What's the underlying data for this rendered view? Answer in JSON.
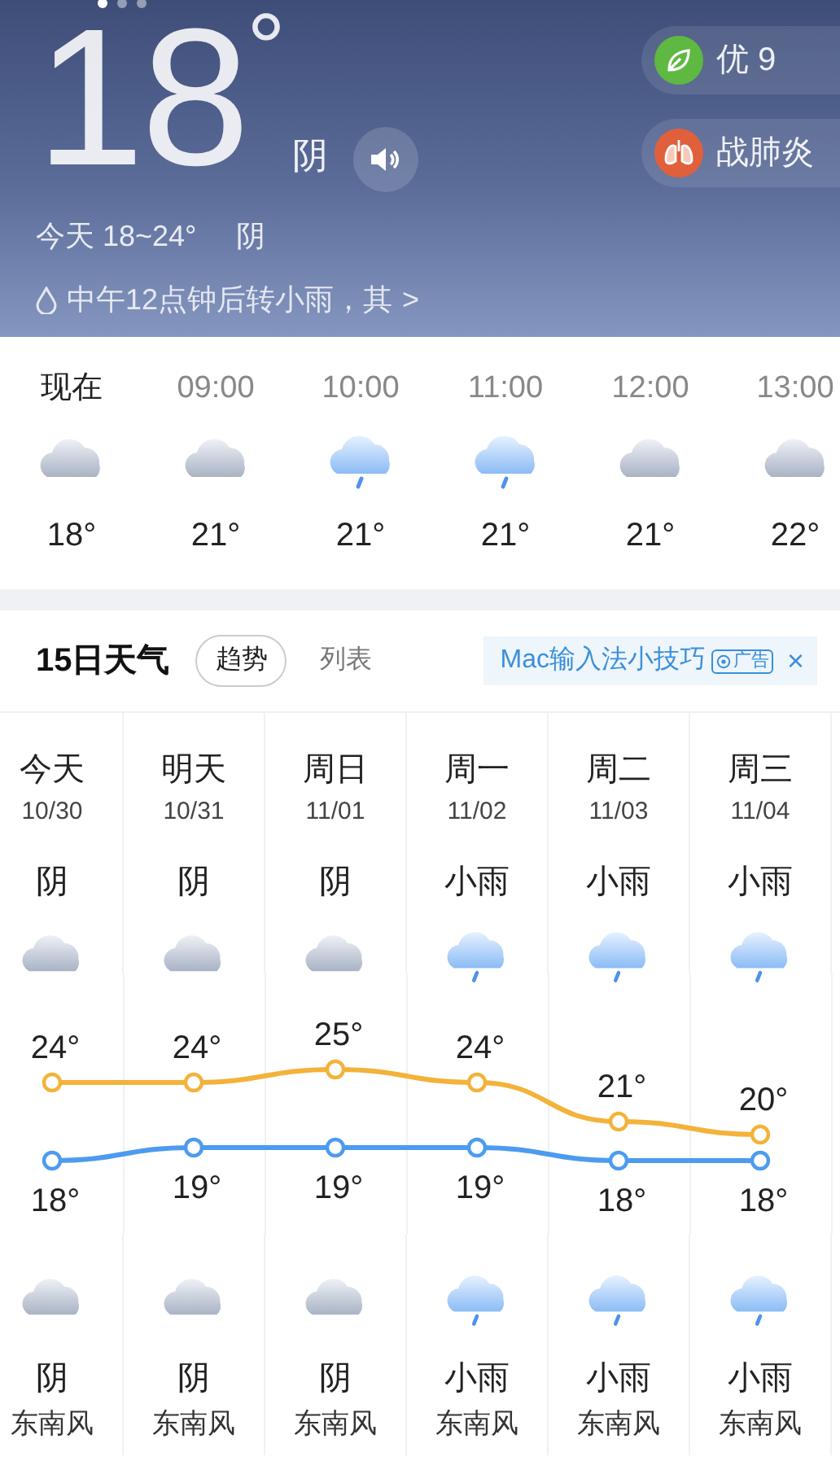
{
  "header": {
    "pager": [
      {
        "selected": true
      },
      {
        "selected": false
      },
      {
        "selected": false
      }
    ],
    "temperature": "18",
    "unit": "°",
    "condition": "阴",
    "badges": [
      {
        "kind": "air",
        "label": "优 9"
      },
      {
        "kind": "health",
        "label": "战肺炎"
      }
    ],
    "today_range": "今天 18~24°",
    "today_condition": "阴",
    "alert": {
      "text": "中午12点钟后转小雨，其",
      "chevron": ">"
    }
  },
  "hourly": [
    {
      "time": "现在",
      "kind": "now",
      "icon": {
        "kind": "cloudy"
      },
      "temp": "18°"
    },
    {
      "time": "09:00",
      "kind": "hour",
      "icon": {
        "kind": "cloudy"
      },
      "temp": "21°"
    },
    {
      "time": "10:00",
      "kind": "hour",
      "icon": {
        "kind": "rain"
      },
      "temp": "21°"
    },
    {
      "time": "11:00",
      "kind": "hour",
      "icon": {
        "kind": "rain"
      },
      "temp": "21°"
    },
    {
      "time": "12:00",
      "kind": "hour",
      "icon": {
        "kind": "cloudy"
      },
      "temp": "21°"
    },
    {
      "time": "13:00",
      "kind": "hour",
      "icon": {
        "kind": "cloudy"
      },
      "temp": "22°"
    }
  ],
  "forecast": {
    "title": "15日天气",
    "tabs": [
      {
        "label": "趋势",
        "selected": true
      },
      {
        "label": "列表",
        "selected": false
      }
    ],
    "ad": {
      "text": "Mac输入法小技巧",
      "tag": "广告",
      "close": "×"
    },
    "days": [
      {
        "name": "今天",
        "date": "10/30",
        "day_condition": "阴",
        "day_icon": {
          "kind": "cloudy"
        },
        "night_icon": {
          "kind": "cloudy"
        },
        "night_condition": "阴",
        "wind": "东南风"
      },
      {
        "name": "明天",
        "date": "10/31",
        "day_condition": "阴",
        "day_icon": {
          "kind": "cloudy"
        },
        "night_icon": {
          "kind": "cloudy"
        },
        "night_condition": "阴",
        "wind": "东南风"
      },
      {
        "name": "周日",
        "date": "11/01",
        "day_condition": "阴",
        "day_icon": {
          "kind": "cloudy"
        },
        "night_icon": {
          "kind": "cloudy"
        },
        "night_condition": "阴",
        "wind": "东南风"
      },
      {
        "name": "周一",
        "date": "11/02",
        "day_condition": "小雨",
        "day_icon": {
          "kind": "rain"
        },
        "night_icon": {
          "kind": "rain"
        },
        "night_condition": "小雨",
        "wind": "东南风"
      },
      {
        "name": "周二",
        "date": "11/03",
        "day_condition": "小雨",
        "day_icon": {
          "kind": "rain"
        },
        "night_icon": {
          "kind": "rain"
        },
        "night_condition": "小雨",
        "wind": "东南风"
      },
      {
        "name": "周三",
        "date": "11/04",
        "day_condition": "小雨",
        "day_icon": {
          "kind": "rain"
        },
        "night_icon": {
          "kind": "rain"
        },
        "night_condition": "小雨",
        "wind": "东南风"
      }
    ],
    "chart_data": {
      "type": "line",
      "series": [
        {
          "color": "#f3b23a",
          "marker": "circle",
          "values": [
            24,
            24,
            25,
            24,
            21,
            20
          ],
          "value_labels": [
            "24°",
            "24°",
            "25°",
            "24°",
            "21°",
            "20°"
          ]
        },
        {
          "color": "#4d9bef",
          "marker": "circle",
          "values": [
            18,
            19,
            19,
            19,
            18,
            18
          ],
          "value_labels": [
            "18°",
            "19°",
            "19°",
            "19°",
            "18°",
            "18°"
          ]
        }
      ]
    }
  }
}
